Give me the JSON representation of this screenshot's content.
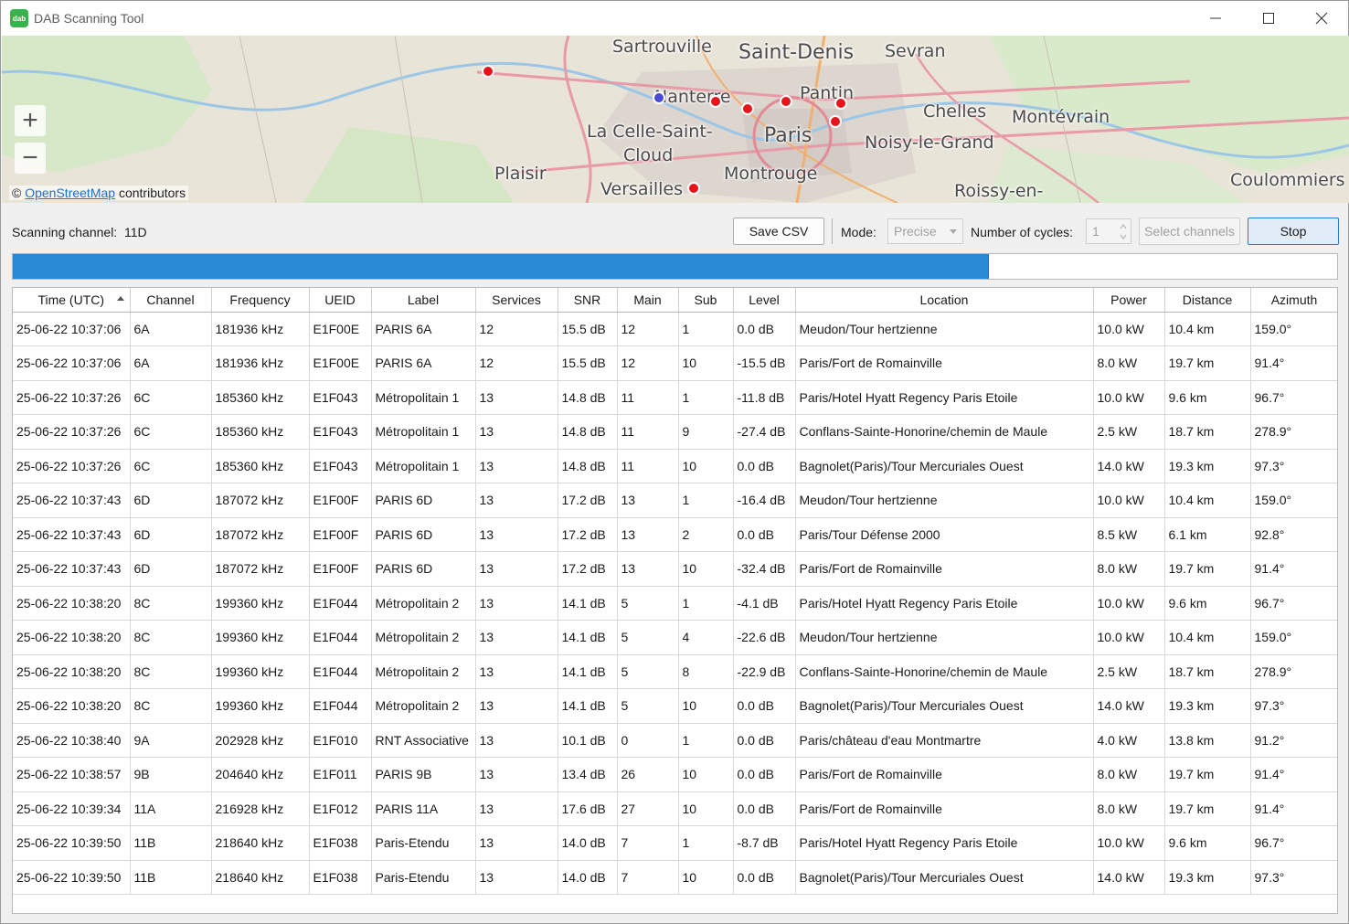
{
  "window": {
    "title": "DAB Scanning Tool",
    "icon_text": "dab",
    "accent": "#2b8ad6"
  },
  "map": {
    "places": [
      "Sartrouville",
      "Saint-Denis",
      "Sevran",
      "Nanterre",
      "Pantin",
      "Chelles",
      "Montévrain",
      "La Celle-Saint-",
      "Cloud",
      "Paris",
      "Noisy-le-Grand",
      "Plaisir",
      "Montrouge",
      "Versailles",
      "Roissy-en-",
      "Coulommiers"
    ],
    "zoom_in": "+",
    "zoom_out": "−",
    "attribution_prefix": "©",
    "attribution_link": "OpenStreetMap",
    "attribution_suffix": "contributors",
    "marker_colors": {
      "transmitter": "#e8141c",
      "receiver": "#4a4ad8"
    }
  },
  "controls": {
    "scanning_label": "Scanning channel:",
    "scanning_channel": "11D",
    "save_csv": "Save CSV",
    "mode_label": "Mode:",
    "mode_value": "Precise",
    "cycles_label": "Number of cycles:",
    "cycles_value": "1",
    "select_channels": "Select channels",
    "stop": "Stop"
  },
  "progress": {
    "fraction": 0.737
  },
  "table": {
    "columns": [
      "Time (UTC)",
      "Channel",
      "Frequency",
      "UEID",
      "Label",
      "Services",
      "SNR",
      "Main",
      "Sub",
      "Level",
      "Location",
      "Power",
      "Distance",
      "Azimuth"
    ],
    "sorted_column": "Time (UTC)",
    "rows": [
      [
        "25-06-22 10:37:06",
        "6A",
        "181936 kHz",
        "E1F00E",
        "PARIS 6A",
        "12",
        "15.5 dB",
        "12",
        "1",
        "0.0 dB",
        "Meudon/Tour hertzienne",
        "10.0 kW",
        "10.4 km",
        "159.0°"
      ],
      [
        "25-06-22 10:37:06",
        "6A",
        "181936 kHz",
        "E1F00E",
        "PARIS 6A",
        "12",
        "15.5 dB",
        "12",
        "10",
        "-15.5 dB",
        "Paris/Fort de Romainville",
        "8.0 kW",
        "19.7 km",
        "91.4°"
      ],
      [
        "25-06-22 10:37:26",
        "6C",
        "185360 kHz",
        "E1F043",
        "Métropolitain 1",
        "13",
        "14.8 dB",
        "11",
        "1",
        "-11.8 dB",
        "Paris/Hotel Hyatt Regency Paris Etoile",
        "10.0 kW",
        "9.6 km",
        "96.7°"
      ],
      [
        "25-06-22 10:37:26",
        "6C",
        "185360 kHz",
        "E1F043",
        "Métropolitain 1",
        "13",
        "14.8 dB",
        "11",
        "9",
        "-27.4 dB",
        "Conflans-Sainte-Honorine/chemin de Maule",
        "2.5 kW",
        "18.7 km",
        "278.9°"
      ],
      [
        "25-06-22 10:37:26",
        "6C",
        "185360 kHz",
        "E1F043",
        "Métropolitain 1",
        "13",
        "14.8 dB",
        "11",
        "10",
        "0.0 dB",
        "Bagnolet(Paris)/Tour Mercuriales Ouest",
        "14.0 kW",
        "19.3 km",
        "97.3°"
      ],
      [
        "25-06-22 10:37:43",
        "6D",
        "187072 kHz",
        "E1F00F",
        "PARIS 6D",
        "13",
        "17.2 dB",
        "13",
        "1",
        "-16.4 dB",
        "Meudon/Tour hertzienne",
        "10.0 kW",
        "10.4 km",
        "159.0°"
      ],
      [
        "25-06-22 10:37:43",
        "6D",
        "187072 kHz",
        "E1F00F",
        "PARIS 6D",
        "13",
        "17.2 dB",
        "13",
        "2",
        "0.0 dB",
        "Paris/Tour Défense 2000",
        "8.5 kW",
        "6.1 km",
        "92.8°"
      ],
      [
        "25-06-22 10:37:43",
        "6D",
        "187072 kHz",
        "E1F00F",
        "PARIS 6D",
        "13",
        "17.2 dB",
        "13",
        "10",
        "-32.4 dB",
        "Paris/Fort de Romainville",
        "8.0 kW",
        "19.7 km",
        "91.4°"
      ],
      [
        "25-06-22 10:38:20",
        "8C",
        "199360 kHz",
        "E1F044",
        "Métropolitain 2",
        "13",
        "14.1 dB",
        "5",
        "1",
        "-4.1 dB",
        "Paris/Hotel Hyatt Regency Paris Etoile",
        "10.0 kW",
        "9.6 km",
        "96.7°"
      ],
      [
        "25-06-22 10:38:20",
        "8C",
        "199360 kHz",
        "E1F044",
        "Métropolitain 2",
        "13",
        "14.1 dB",
        "5",
        "4",
        "-22.6 dB",
        "Meudon/Tour hertzienne",
        "10.0 kW",
        "10.4 km",
        "159.0°"
      ],
      [
        "25-06-22 10:38:20",
        "8C",
        "199360 kHz",
        "E1F044",
        "Métropolitain 2",
        "13",
        "14.1 dB",
        "5",
        "8",
        "-22.9 dB",
        "Conflans-Sainte-Honorine/chemin de Maule",
        "2.5 kW",
        "18.7 km",
        "278.9°"
      ],
      [
        "25-06-22 10:38:20",
        "8C",
        "199360 kHz",
        "E1F044",
        "Métropolitain 2",
        "13",
        "14.1 dB",
        "5",
        "10",
        "0.0 dB",
        "Bagnolet(Paris)/Tour Mercuriales Ouest",
        "14.0 kW",
        "19.3 km",
        "97.3°"
      ],
      [
        "25-06-22 10:38:40",
        "9A",
        "202928 kHz",
        "E1F010",
        "RNT Associative",
        "13",
        "10.1 dB",
        "0",
        "1",
        "0.0 dB",
        "Paris/château d'eau Montmartre",
        "4.0 kW",
        "13.8 km",
        "91.2°"
      ],
      [
        "25-06-22 10:38:57",
        "9B",
        "204640 kHz",
        "E1F011",
        "PARIS 9B",
        "13",
        "13.4 dB",
        "26",
        "10",
        "0.0 dB",
        "Paris/Fort de Romainville",
        "8.0 kW",
        "19.7 km",
        "91.4°"
      ],
      [
        "25-06-22 10:39:34",
        "11A",
        "216928 kHz",
        "E1F012",
        "PARIS 11A",
        "13",
        "17.6 dB",
        "27",
        "10",
        "0.0 dB",
        "Paris/Fort de Romainville",
        "8.0 kW",
        "19.7 km",
        "91.4°"
      ],
      [
        "25-06-22 10:39:50",
        "11B",
        "218640 kHz",
        "E1F038",
        "Paris-Etendu",
        "13",
        "14.0 dB",
        "7",
        "1",
        "-8.7 dB",
        "Paris/Hotel Hyatt Regency Paris Etoile",
        "10.0 kW",
        "9.6 km",
        "96.7°"
      ],
      [
        "25-06-22 10:39:50",
        "11B",
        "218640 kHz",
        "E1F038",
        "Paris-Etendu",
        "13",
        "14.0 dB",
        "7",
        "10",
        "0.0 dB",
        "Bagnolet(Paris)/Tour Mercuriales Ouest",
        "14.0 kW",
        "19.3 km",
        "97.3°"
      ]
    ]
  }
}
